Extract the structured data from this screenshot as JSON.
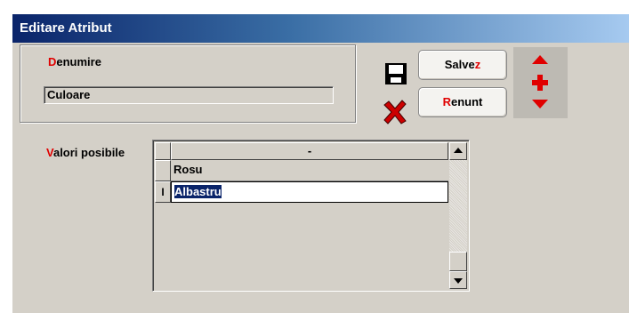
{
  "window": {
    "title": "Editare Atribut"
  },
  "denumire": {
    "label_hot": "D",
    "label_rest": "enumire",
    "value": "Culoare"
  },
  "buttons": {
    "save": {
      "label_plain": "Salve",
      "label_hot": "z",
      "icon": "floppy-disk-icon"
    },
    "cancel": {
      "label_hot": "R",
      "label_rest": "enunt",
      "icon": "red-x-icon"
    }
  },
  "nav": {
    "up": "arrow-up-icon",
    "add": "plus-icon",
    "down": "arrow-down-icon"
  },
  "valori": {
    "label_hot": "V",
    "label_rest": "alori posibile",
    "column_header": "-",
    "rows": [
      {
        "value": "Rosu"
      },
      {
        "value": "Albastru",
        "editing": true,
        "row_marker": "I"
      }
    ]
  },
  "colors": {
    "accent_red": "#e00000",
    "title_blue": "#0a246a"
  }
}
